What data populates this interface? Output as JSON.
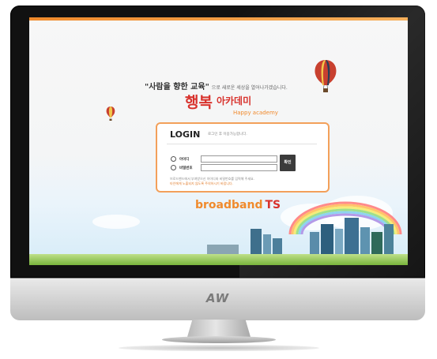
{
  "monitor": {
    "brand_label": "AW"
  },
  "page": {
    "slogan": "\"사람을 향한 교육\"",
    "slogan_sub": "으로 새로운 세상을 열어나가겠습니다.",
    "logo_main": "행복",
    "logo_accent": "아카데미",
    "logo_sub": "Happy academy"
  },
  "login": {
    "title": "LOGIN",
    "subtitle": "로그인 후 이용가능합니다.",
    "id_label": "아이디",
    "pw_label": "비밀번호",
    "id_value": "",
    "pw_value": "",
    "submit_label": "확인",
    "note_line1": "브로드밴드에서 부여받으신 아이디와 비밀번호를 입력해 주세요.",
    "note_line2": "타인에게 노출되지 않도록 주의하시기 바랍니다."
  },
  "footer": {
    "brand": "broadband",
    "brand_accent": "TS"
  },
  "colors": {
    "accent": "#f08a2c",
    "brand_red": "#d8322c",
    "box_border": "#f3a05a"
  }
}
